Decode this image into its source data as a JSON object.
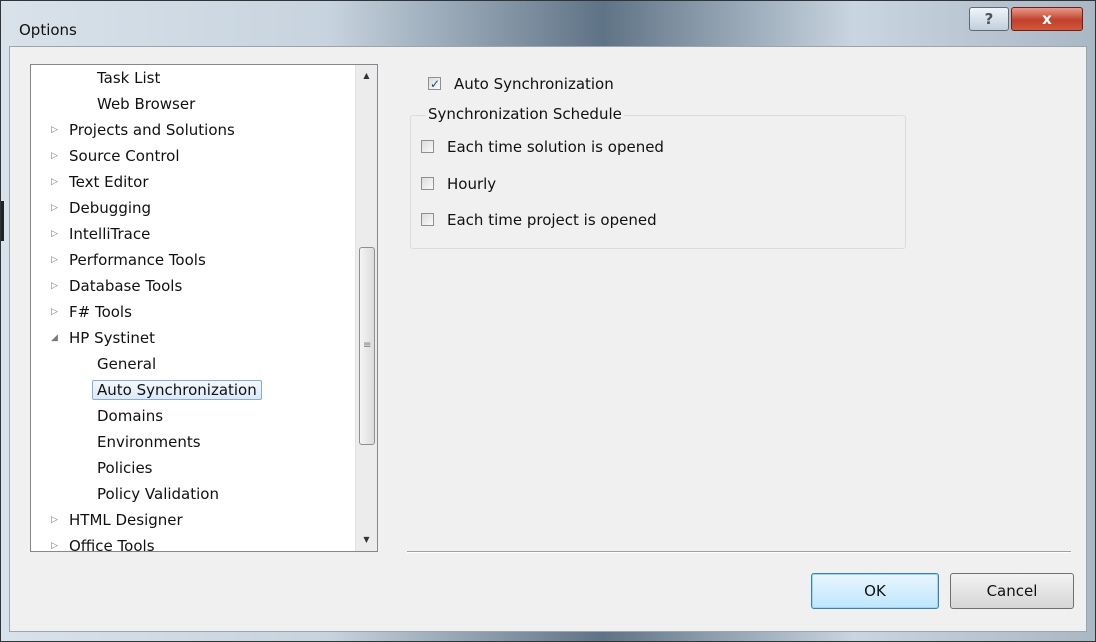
{
  "window": {
    "title": "Options"
  },
  "titlebar": {
    "help_glyph": "?",
    "close_glyph": "x"
  },
  "tree": {
    "items": [
      {
        "label": "Task List",
        "level": 1,
        "arrow": ""
      },
      {
        "label": "Web Browser",
        "level": 1,
        "arrow": ""
      },
      {
        "label": "Projects and Solutions",
        "level": 0,
        "arrow": "▷"
      },
      {
        "label": "Source Control",
        "level": 0,
        "arrow": "▷"
      },
      {
        "label": "Text Editor",
        "level": 0,
        "arrow": "▷"
      },
      {
        "label": "Debugging",
        "level": 0,
        "arrow": "▷"
      },
      {
        "label": "IntelliTrace",
        "level": 0,
        "arrow": "▷"
      },
      {
        "label": "Performance Tools",
        "level": 0,
        "arrow": "▷"
      },
      {
        "label": "Database Tools",
        "level": 0,
        "arrow": "▷"
      },
      {
        "label": "F# Tools",
        "level": 0,
        "arrow": "▷"
      },
      {
        "label": "HP Systinet",
        "level": 0,
        "arrow": "◢"
      },
      {
        "label": "General",
        "level": 1,
        "arrow": ""
      },
      {
        "label": "Auto Synchronization",
        "level": 1,
        "arrow": "",
        "selected": true
      },
      {
        "label": "Domains",
        "level": 1,
        "arrow": ""
      },
      {
        "label": "Environments",
        "level": 1,
        "arrow": ""
      },
      {
        "label": "Policies",
        "level": 1,
        "arrow": ""
      },
      {
        "label": "Policy Validation",
        "level": 1,
        "arrow": ""
      },
      {
        "label": "HTML Designer",
        "level": 0,
        "arrow": "▷"
      },
      {
        "label": "Office Tools",
        "level": 0,
        "arrow": "▷"
      }
    ],
    "scroll_up_glyph": "▲",
    "scroll_down_glyph": "▼",
    "scroll_grip_glyph": "≡"
  },
  "settings": {
    "auto_sync": {
      "label": "Auto Synchronization",
      "checked": true
    },
    "schedule_title": "Synchronization Schedule",
    "schedule_options": [
      {
        "label": "Each time solution is opened",
        "checked": false
      },
      {
        "label": "Hourly",
        "checked": false
      },
      {
        "label": "Each time project is opened",
        "checked": false
      }
    ]
  },
  "buttons": {
    "ok": "OK",
    "cancel": "Cancel"
  },
  "check_glyph": "✓"
}
